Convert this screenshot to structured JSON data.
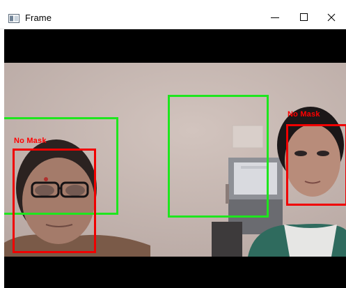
{
  "window": {
    "title": "Frame",
    "icons": {
      "app": "frame-app-icon",
      "minimize": "minimize-icon",
      "maximize": "maximize-icon",
      "close": "close-icon"
    }
  },
  "video": {
    "detections": [
      {
        "label": "No Mask",
        "color": "#f00000"
      },
      {
        "label": "No Mask",
        "color": "#f00000"
      },
      {
        "label": "",
        "color": "#1ee61e"
      },
      {
        "label": "",
        "color": "#1ee61e"
      }
    ]
  }
}
